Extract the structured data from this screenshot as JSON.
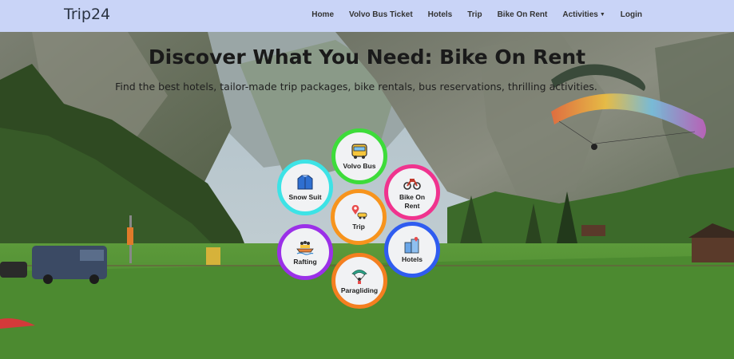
{
  "brand": "Trip24",
  "nav": {
    "items": [
      "Home",
      "Volvo Bus Ticket",
      "Hotels",
      "Trip",
      "Bike On Rent",
      "Activities",
      "Login"
    ]
  },
  "hero": {
    "title": "Discover What You Need: Bike On Rent",
    "subtitle": "Find the best hotels, tailor-made trip packages, bike rentals, bus reservations, thrilling activities."
  },
  "services": {
    "volvo_bus": {
      "label": "Volvo Bus",
      "icon": "bus-icon",
      "color": "#3ddc3a"
    },
    "bike_on_rent": {
      "label": "Bike On Rent",
      "icon": "motorbike-icon",
      "color": "#f0338e"
    },
    "snow_suit": {
      "label": "Snow Suit",
      "icon": "jacket-icon",
      "color": "#3de3e6"
    },
    "trip": {
      "label": "Trip",
      "icon": "map-pin-car-icon",
      "color": "#f7941d"
    },
    "hotels": {
      "label": "Hotels",
      "icon": "buildings-icon",
      "color": "#2f5cf0"
    },
    "rafting": {
      "label": "Rafting",
      "icon": "raft-icon",
      "color": "#9b30e8"
    },
    "paragliding": {
      "label": "Paragliding",
      "icon": "paraglider-icon",
      "color": "#f47f20"
    }
  }
}
